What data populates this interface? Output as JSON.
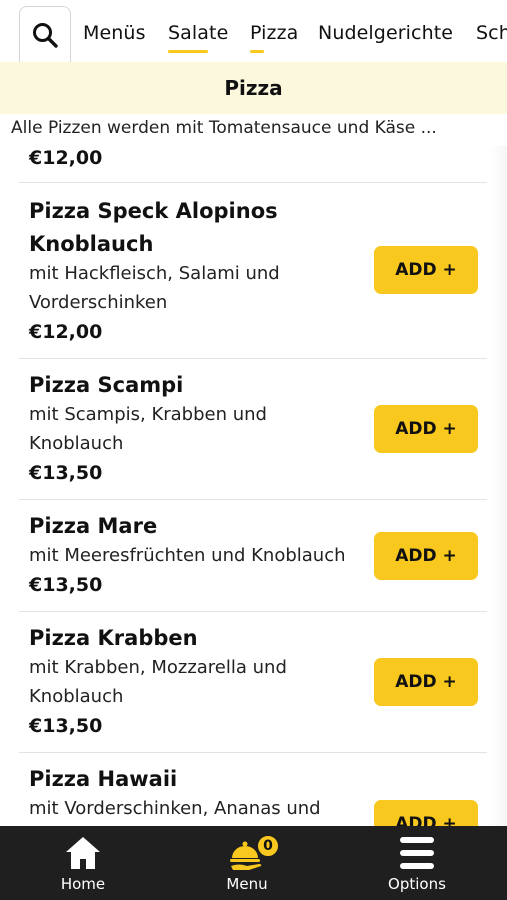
{
  "tabs": [
    "Menüs",
    "Salate",
    "Pizza",
    "Nudelgerichte",
    "Sch"
  ],
  "section": {
    "title": "Pizza",
    "description": "Alle Pizzen werden mit Tomatensauce und Käse ..."
  },
  "prev_item_price": "€12,00",
  "items": [
    {
      "name_l1": "Pizza Speck Alopinos",
      "name_l2": "Knoblauch",
      "desc_l1": "mit Hackfleisch, Salami und",
      "desc_l2": "Vorderschinken",
      "price": "€12,00",
      "add": "ADD +"
    },
    {
      "name_l1": "Pizza Scampi",
      "desc_l1": "mit Scampis, Krabben und",
      "desc_l2": "Knoblauch",
      "price": "€13,50",
      "add": "ADD +"
    },
    {
      "name_l1": "Pizza Mare",
      "desc_l1": "mit Meeresfrüchten und Knoblauch",
      "price": "€13,50",
      "add": "ADD +"
    },
    {
      "name_l1": "Pizza Krabben",
      "desc_l1": "mit Krabben, Mozzarella und",
      "desc_l2": "Knoblauch",
      "price": "€13,50",
      "add": "ADD +"
    },
    {
      "name_l1": "Pizza Hawaii",
      "desc_l1": "mit Vorderschinken, Ananas und",
      "add": "ADD +"
    }
  ],
  "nav": {
    "home": "Home",
    "menu": "Menu",
    "options": "Options",
    "cart_count": "0"
  },
  "colors": {
    "accent": "#f8c81f",
    "header_bg": "#fbf8dd",
    "nav_bg": "#1f1f1f"
  },
  "icons": [
    "search-icon",
    "home-icon",
    "cloche-icon",
    "hamburger-icon"
  ]
}
